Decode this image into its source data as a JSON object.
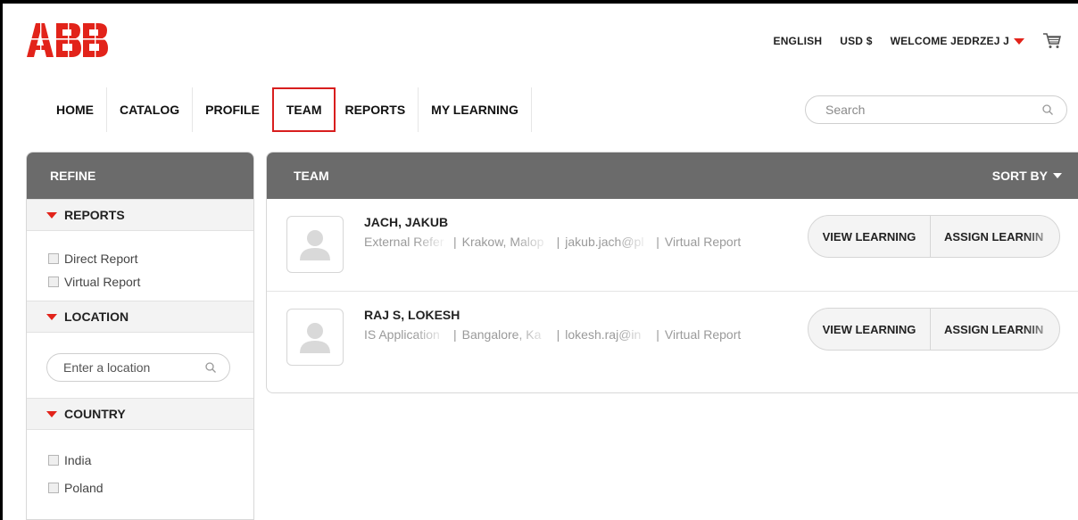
{
  "header": {
    "logo_text": "ABB",
    "language": "ENGLISH",
    "currency": "USD $",
    "welcome": "WELCOME JEDRZEJ J",
    "cart_icon": "cart-icon",
    "brand_color": "#e2231a"
  },
  "nav": {
    "items": [
      {
        "label": "HOME"
      },
      {
        "label": "CATALOG"
      },
      {
        "label": "PROFILE"
      },
      {
        "label": "TEAM",
        "active": true
      },
      {
        "label": "REPORTS"
      },
      {
        "label": "MY LEARNING"
      }
    ],
    "active_outline_color": "#d81e1e"
  },
  "search": {
    "placeholder": "Search"
  },
  "refine": {
    "title": "REFINE",
    "reports": {
      "title": "REPORTS",
      "options": [
        "Direct Report",
        "Virtual Report"
      ]
    },
    "location": {
      "title": "LOCATION",
      "placeholder": "Enter a location"
    },
    "country": {
      "title": "COUNTRY",
      "options": [
        "India",
        "Poland"
      ]
    }
  },
  "team": {
    "title": "TEAM",
    "sort_label": "SORT BY",
    "members": [
      {
        "name": "JACH, JAKUB",
        "role": "External Refer",
        "location": "Krakow, Malop",
        "email": "jakub.jach@pl",
        "report_type": "Virtual Report",
        "view_label": "VIEW LEARNING",
        "assign_label": "ASSIGN LEARNIN"
      },
      {
        "name": "RAJ S, LOKESH",
        "role": "IS Application",
        "location": "Bangalore, Ka",
        "email": "lokesh.raj@in",
        "report_type": "Virtual Report",
        "view_label": "VIEW LEARNING",
        "assign_label": "ASSIGN LEARNIN"
      }
    ]
  }
}
